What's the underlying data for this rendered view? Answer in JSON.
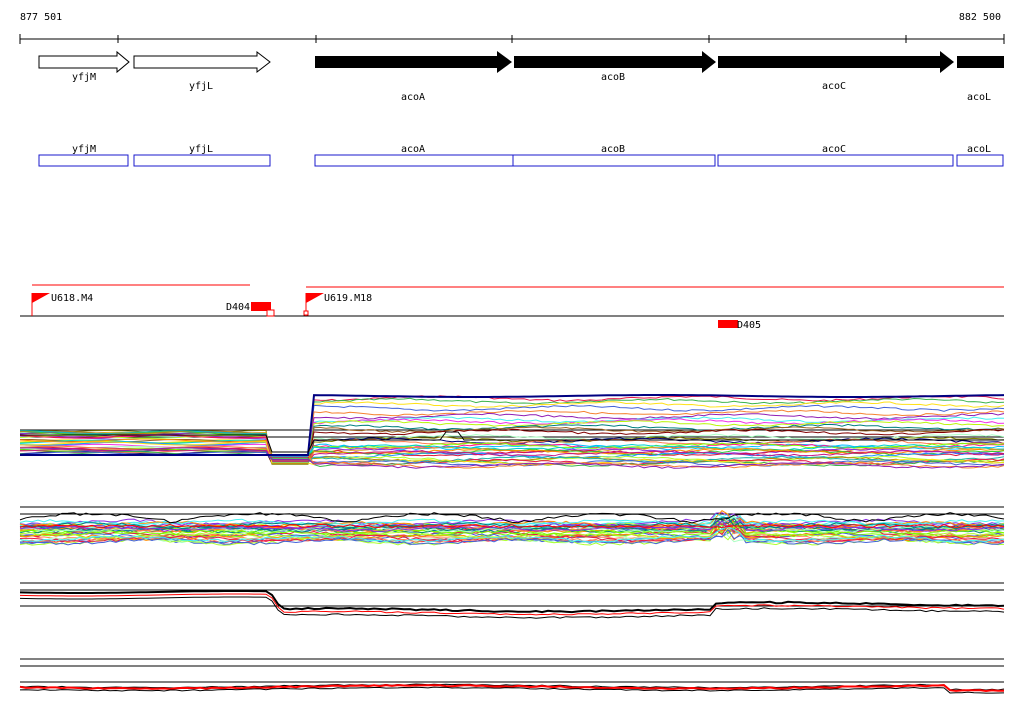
{
  "range": {
    "start": "877 501",
    "end": "882 500"
  },
  "colors": {
    "gene_fill": "#000000",
    "annotation_box": "#1a1acc",
    "signal_red": "#ff0000",
    "axis": "#000000"
  },
  "genes": [
    {
      "id": "yfjM",
      "label": "yfjM",
      "strand": "+",
      "filled": false
    },
    {
      "id": "yfjL",
      "label": "yfjL",
      "strand": "+",
      "filled": false
    },
    {
      "id": "acoA",
      "label": "acoA",
      "strand": "+",
      "filled": true
    },
    {
      "id": "acoB",
      "label": "acoB",
      "strand": "+",
      "filled": true
    },
    {
      "id": "acoC",
      "label": "acoC",
      "strand": "+",
      "filled": true
    },
    {
      "id": "acoL",
      "label": "acoL",
      "strand": "+",
      "filled": true
    }
  ],
  "annotations": [
    "yfjM",
    "yfjL",
    "acoA",
    "acoB",
    "acoC",
    "acoL"
  ],
  "markers": [
    {
      "id": "U618",
      "label": "U618.M4",
      "kind": "flag"
    },
    {
      "id": "U619",
      "label": "U619.M18",
      "kind": "flag"
    },
    {
      "id": "D404",
      "label": "D404",
      "kind": "block"
    },
    {
      "id": "D405",
      "label": "D405",
      "kind": "block"
    }
  ],
  "tracks": [
    {
      "name": "expression-track-1",
      "series_count": 40,
      "style": "multicolor"
    },
    {
      "name": "expression-track-2",
      "series_count": 40,
      "style": "multicolor"
    },
    {
      "name": "expression-track-3",
      "series_count": 3,
      "style": "black-red"
    },
    {
      "name": "expression-track-4",
      "series_count": 3,
      "style": "black-red"
    }
  ]
}
